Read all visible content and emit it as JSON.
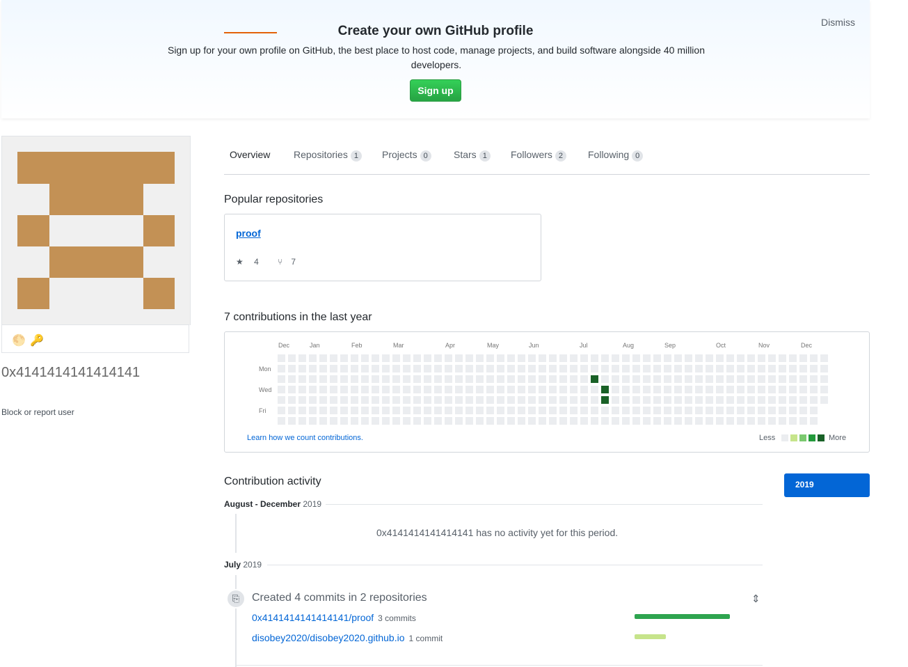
{
  "banner": {
    "title": "Create your own GitHub profile",
    "subtitle": "Sign up for your own profile on GitHub, the best place to host code, manage projects, and build software alongside 40 million developers.",
    "signup_label": "Sign up",
    "dismiss_label": "Dismiss"
  },
  "profile": {
    "username": "0x4141414141414141",
    "block_label": "Block or report user",
    "badges": [
      "🌕",
      "🔑"
    ]
  },
  "tabs": [
    {
      "label": "Overview",
      "count": null,
      "selected": true
    },
    {
      "label": "Repositories",
      "count": "1"
    },
    {
      "label": "Projects",
      "count": "0"
    },
    {
      "label": "Stars",
      "count": "1"
    },
    {
      "label": "Followers",
      "count": "2"
    },
    {
      "label": "Following",
      "count": "0"
    }
  ],
  "popular": {
    "title": "Popular repositories",
    "repo": {
      "name": "proof",
      "stars": "4",
      "forks": "7"
    }
  },
  "contributions": {
    "title": "7 contributions in the last year",
    "months": [
      "Dec",
      "Jan",
      "Feb",
      "Mar",
      "Apr",
      "May",
      "Jun",
      "Jul",
      "Aug",
      "Sep",
      "Oct",
      "Nov",
      "Dec"
    ],
    "days": [
      "Mon",
      "Wed",
      "Fri"
    ],
    "learn_label": "Learn how we count contributions.",
    "less_label": "Less",
    "more_label": "More",
    "colors": [
      "#ebedf0",
      "#c6e48b",
      "#7bc96f",
      "#239a3b",
      "#196127"
    ]
  },
  "activity": {
    "title": "Contribution activity",
    "year": "2019",
    "period1": {
      "label": "August - December",
      "year": "2019"
    },
    "no_activity": "0x4141414141414141 has no activity yet for this period.",
    "period2": {
      "label": "July",
      "year": "2019"
    },
    "commits_title": "Created 4 commits in 2 repositories",
    "repos": [
      {
        "name": "0x4141414141414141/proof",
        "commits": "3 commits",
        "fraction": 1.0,
        "color": "#2ea44f"
      },
      {
        "name": "disobey2020/disobey2020.github.io",
        "commits": "1 commit",
        "fraction": 0.33,
        "color": "#c6e48b"
      }
    ]
  }
}
